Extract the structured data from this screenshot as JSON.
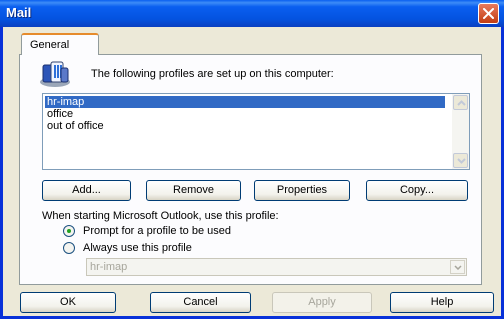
{
  "window": {
    "title": "Mail"
  },
  "tabs": [
    {
      "label": "General",
      "active": true
    }
  ],
  "intro_text": "The following profiles are set up on this computer:",
  "profiles": [
    {
      "name": "hr-imap",
      "selected": true
    },
    {
      "name": "office",
      "selected": false
    },
    {
      "name": "out of office",
      "selected": false
    }
  ],
  "profile_buttons": {
    "add": "Add...",
    "remove": "Remove",
    "properties": "Properties",
    "copy": "Copy..."
  },
  "startup_label": "When starting Microsoft Outlook, use this profile:",
  "startup_options": [
    {
      "label": "Prompt for a profile to be used",
      "checked": true
    },
    {
      "label": "Always use this profile",
      "checked": false
    }
  ],
  "default_profile": {
    "value": "hr-imap",
    "enabled": false
  },
  "dialog_buttons": {
    "ok": "OK",
    "cancel": "Cancel",
    "apply": "Apply",
    "help": "Help"
  },
  "colors": {
    "titlebar": "#0a5ff0",
    "selection": "#316ac5",
    "radio_dot": "#21a121",
    "tab_highlight": "#e68b2c"
  },
  "icons": {
    "close": "close-icon",
    "profiles": "mail-profiles-icon"
  }
}
